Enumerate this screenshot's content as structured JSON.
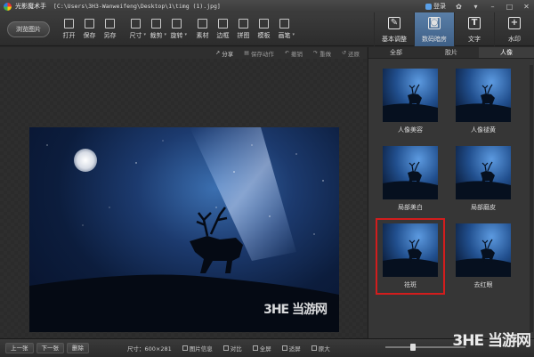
{
  "window": {
    "app_name": "光影魔术手",
    "file_path": "[C:\\Users\\3H3-Wanweifeng\\Desktop\\1\\timg (1).jpg]",
    "login_label": "登录"
  },
  "toolbar": {
    "browse_label": "浏览图片",
    "tools": [
      {
        "label": "打开",
        "icon": "open-icon",
        "caret": false
      },
      {
        "label": "保存",
        "icon": "save-icon",
        "caret": false
      },
      {
        "label": "另存",
        "icon": "save-as-icon",
        "caret": false
      },
      {
        "label": "尺寸",
        "icon": "resize-icon",
        "caret": true
      },
      {
        "label": "裁剪",
        "icon": "crop-icon",
        "caret": true
      },
      {
        "label": "旋转",
        "icon": "rotate-icon",
        "caret": true
      },
      {
        "label": "素材",
        "icon": "material-icon",
        "caret": false
      },
      {
        "label": "边框",
        "icon": "frame-icon",
        "caret": false
      },
      {
        "label": "拼图",
        "icon": "collage-icon",
        "caret": false
      },
      {
        "label": "模板",
        "icon": "template-icon",
        "caret": false
      },
      {
        "label": "画笔",
        "icon": "brush-icon",
        "caret": true
      }
    ],
    "big_tabs": [
      {
        "label": "基本调整",
        "icon": "edit-icon",
        "glyph": "✎"
      },
      {
        "label": "数码暗房",
        "icon": "camera-icon",
        "glyph": "◙"
      },
      {
        "label": "文字",
        "icon": "text-icon",
        "glyph": "T"
      },
      {
        "label": "水印",
        "icon": "watermark-icon",
        "glyph": "+"
      }
    ]
  },
  "actions": [
    {
      "label": "分享",
      "glyph": "↗",
      "enabled": true
    },
    {
      "label": "保存动作",
      "glyph": "▤",
      "enabled": false
    },
    {
      "label": "撤销",
      "glyph": "↶",
      "enabled": false
    },
    {
      "label": "重做",
      "glyph": "↷",
      "enabled": false
    },
    {
      "label": "还原",
      "glyph": "↺",
      "enabled": false
    }
  ],
  "filters": {
    "tabs": [
      "全部",
      "胶片",
      "人像"
    ],
    "active_tab_index": 2,
    "items": [
      {
        "label": "人像美容",
        "selected": false
      },
      {
        "label": "人像褪黄",
        "selected": false
      },
      {
        "label": "局部美白",
        "selected": false
      },
      {
        "label": "局部磨皮",
        "selected": false
      },
      {
        "label": "祛斑",
        "selected": true
      },
      {
        "label": "去红眼",
        "selected": false
      }
    ]
  },
  "watermark_text": "3HE 当游网",
  "status": {
    "prev_label": "上一张",
    "next_label": "下一张",
    "delete_label": "删除",
    "size_label": "尺寸：600×281",
    "info_label": "图片信息",
    "compare_label": "对比",
    "fullscreen_label": "全屏",
    "fit_label": "适屏",
    "original_label": "原大",
    "zoom_fraction": 0.33
  },
  "colors": {
    "accent_tab": "#4a6f9a",
    "selection": "#d21d1d"
  }
}
